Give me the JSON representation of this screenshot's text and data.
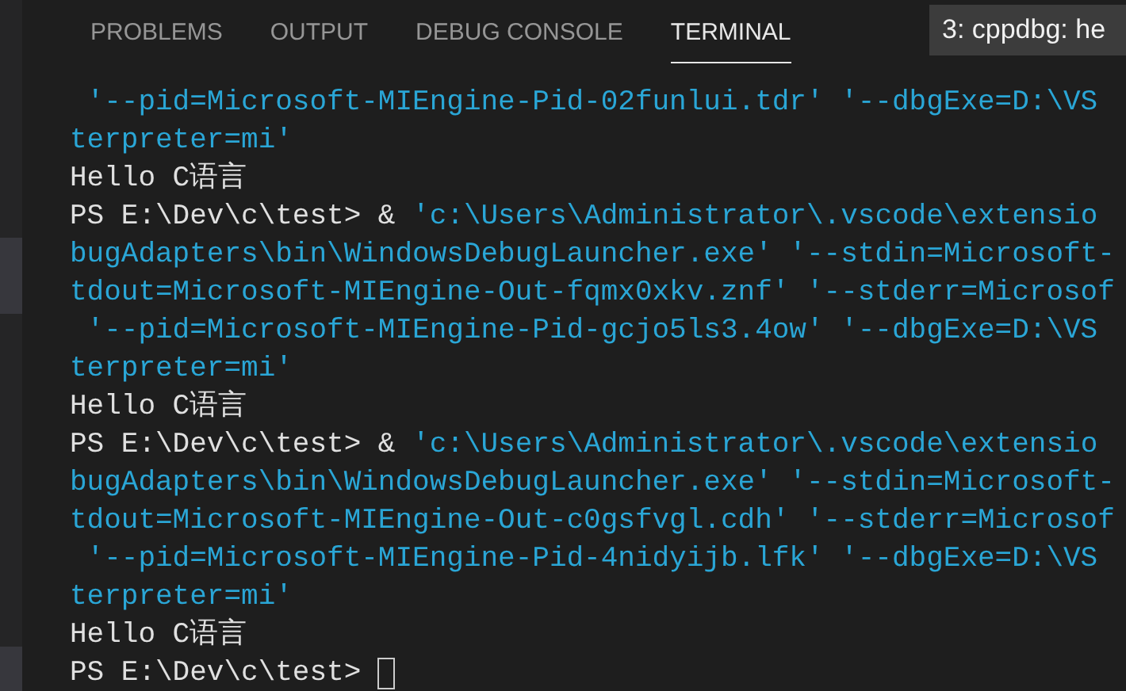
{
  "panel_tabs": [
    {
      "label": "PROBLEMS",
      "selected": false
    },
    {
      "label": "OUTPUT",
      "selected": false
    },
    {
      "label": "DEBUG CONSOLE",
      "selected": false
    },
    {
      "label": "TERMINAL",
      "selected": true
    }
  ],
  "terminal_selector": {
    "value": "3: cppdbg: he"
  },
  "terminal_lines": [
    [
      {
        "kind": "string",
        "text": " '--pid=Microsoft-MIEngine-Pid-02funlui.tdr' '--dbgExe=D:\\VS"
      }
    ],
    [
      {
        "kind": "string",
        "text": "terpreter=mi'"
      }
    ],
    [
      {
        "kind": "output",
        "text": "Hello C语言"
      }
    ],
    [
      {
        "kind": "output",
        "text": "PS E:\\Dev\\c\\test> & "
      },
      {
        "kind": "string",
        "text": "'c:\\Users\\Administrator\\.vscode\\extensio"
      }
    ],
    [
      {
        "kind": "string",
        "text": "bugAdapters\\bin\\WindowsDebugLauncher.exe' '--stdin=Microsoft-"
      }
    ],
    [
      {
        "kind": "string",
        "text": "tdout=Microsoft-MIEngine-Out-fqmx0xkv.znf' '--stderr=Microsof"
      }
    ],
    [
      {
        "kind": "string",
        "text": " '--pid=Microsoft-MIEngine-Pid-gcjo5ls3.4ow' '--dbgExe=D:\\VS"
      }
    ],
    [
      {
        "kind": "string",
        "text": "terpreter=mi'"
      }
    ],
    [
      {
        "kind": "output",
        "text": "Hello C语言"
      }
    ],
    [
      {
        "kind": "output",
        "text": "PS E:\\Dev\\c\\test> & "
      },
      {
        "kind": "string",
        "text": "'c:\\Users\\Administrator\\.vscode\\extensio"
      }
    ],
    [
      {
        "kind": "string",
        "text": "bugAdapters\\bin\\WindowsDebugLauncher.exe' '--stdin=Microsoft-"
      }
    ],
    [
      {
        "kind": "string",
        "text": "tdout=Microsoft-MIEngine-Out-c0gsfvgl.cdh' '--stderr=Microsof"
      }
    ],
    [
      {
        "kind": "string",
        "text": " '--pid=Microsoft-MIEngine-Pid-4nidyijb.lfk' '--dbgExe=D:\\VS"
      }
    ],
    [
      {
        "kind": "string",
        "text": "terpreter=mi'"
      }
    ],
    [
      {
        "kind": "output",
        "text": "Hello C语言"
      }
    ],
    [
      {
        "kind": "output",
        "text": "PS E:\\Dev\\c\\test> "
      },
      {
        "kind": "cursor"
      }
    ]
  ]
}
